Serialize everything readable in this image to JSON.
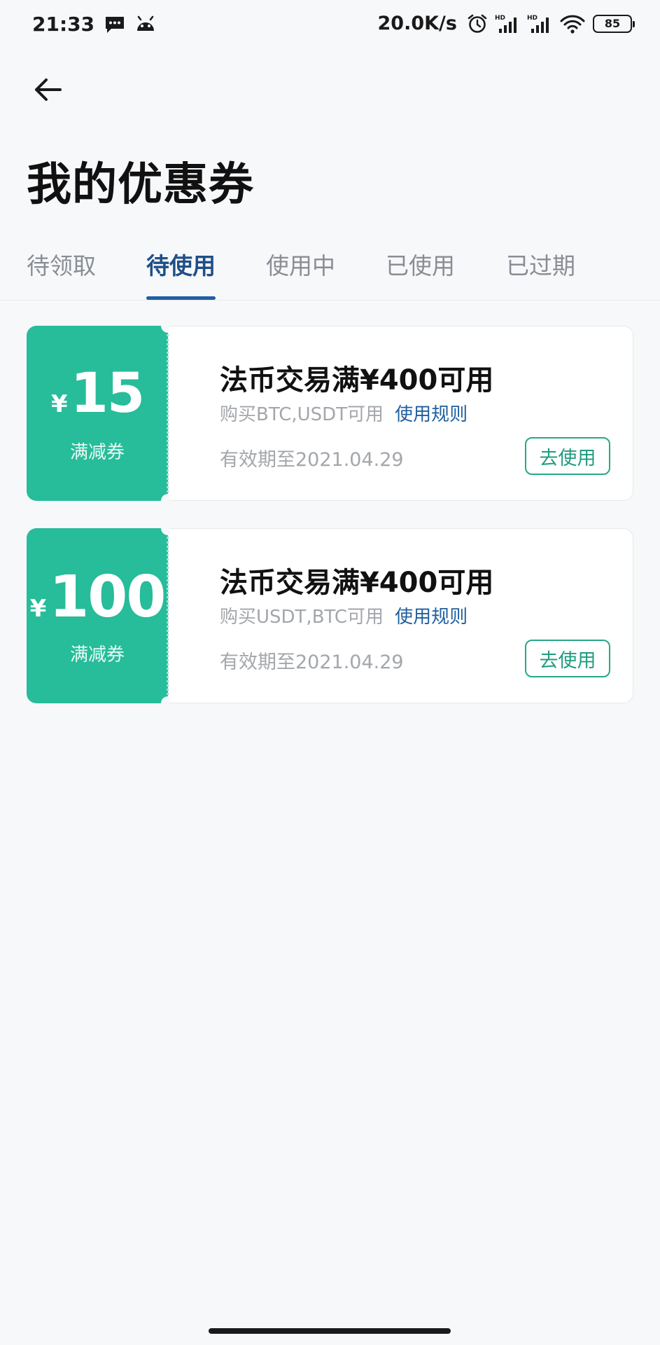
{
  "status_bar": {
    "time": "21:33",
    "net_speed": "20.0K/s",
    "battery": "85",
    "icons": [
      "message-icon",
      "android-icon",
      "alarm-icon",
      "signal-hd-icon",
      "signal-hd-icon",
      "wifi-icon",
      "battery-icon"
    ]
  },
  "header": {
    "back_icon": "arrow-left-icon",
    "title": "我的优惠券"
  },
  "tabs": [
    {
      "label": "待领取",
      "active": false
    },
    {
      "label": "待使用",
      "active": true
    },
    {
      "label": "使用中",
      "active": false
    },
    {
      "label": "已使用",
      "active": false
    },
    {
      "label": "已过期",
      "active": false
    }
  ],
  "coupons": [
    {
      "currency": "¥",
      "amount": "15",
      "type": "满减券",
      "title": "法币交易满¥400可用",
      "desc": "购买BTC,USDT可用",
      "rules_link": "使用规则",
      "expiry": "有效期至2021.04.29",
      "button": "去使用"
    },
    {
      "currency": "¥",
      "amount": "100",
      "type": "满减券",
      "title": "法币交易满¥400可用",
      "desc": "购买USDT,BTC可用",
      "rules_link": "使用规则",
      "expiry": "有效期至2021.04.29",
      "button": "去使用"
    }
  ],
  "colors": {
    "accent_green": "#27bc9a",
    "tab_active": "#1f5fa3",
    "link_blue": "#1f5f9e",
    "background": "#f7f8fa"
  }
}
